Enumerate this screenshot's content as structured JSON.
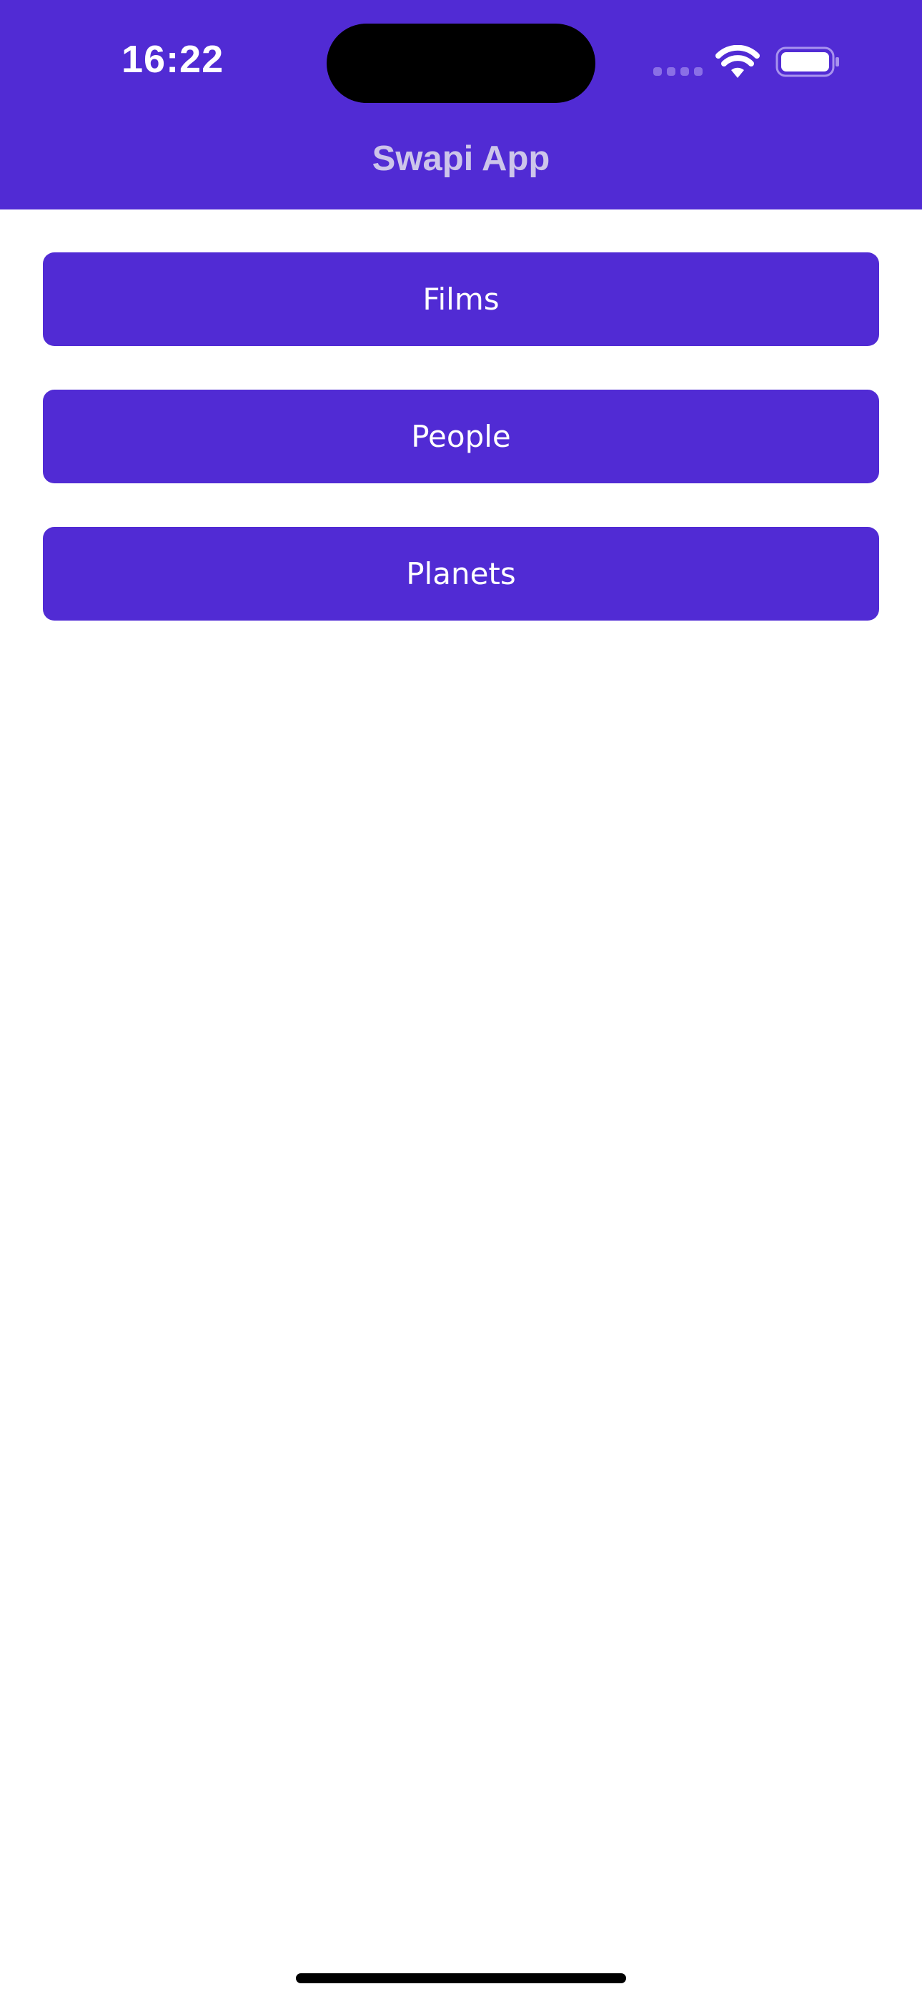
{
  "status_bar": {
    "time": "16:22",
    "signal_icon": "cellular-signal-icon",
    "wifi_icon": "wifi-icon",
    "battery_icon": "battery-icon"
  },
  "nav_bar": {
    "title": "Swapi App"
  },
  "menu": {
    "buttons": [
      {
        "label": "Films"
      },
      {
        "label": "People"
      },
      {
        "label": "Planets"
      }
    ]
  },
  "colors": {
    "accent": "#512bd4",
    "nav_title": "#cdc5ea",
    "background": "#ffffff"
  }
}
